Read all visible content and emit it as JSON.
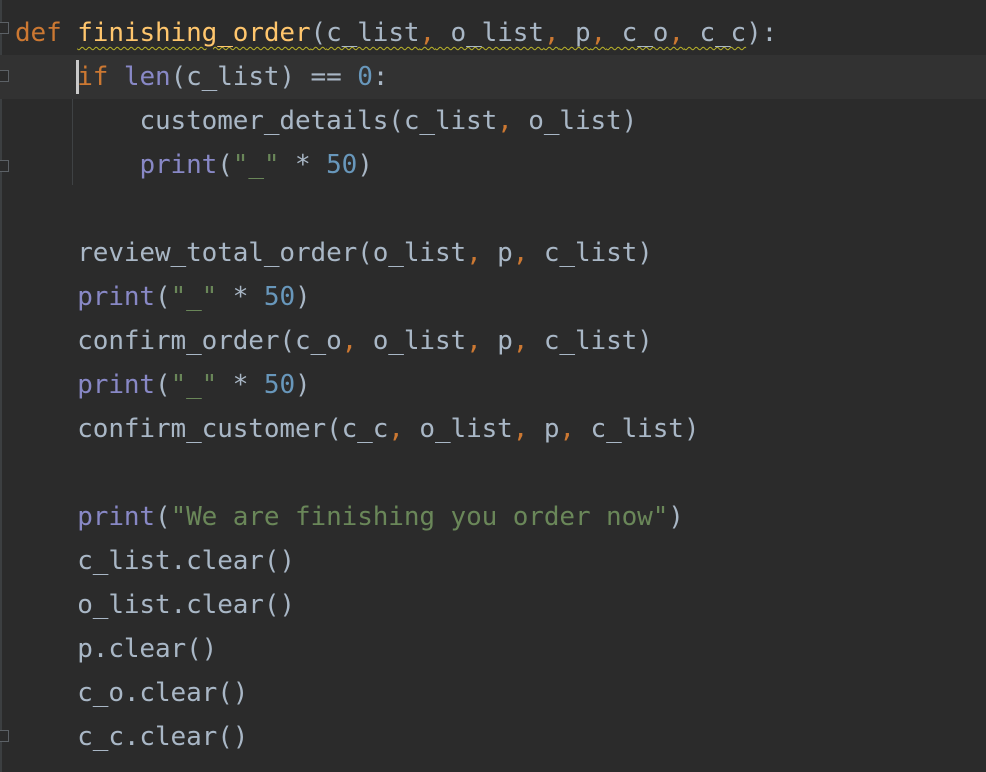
{
  "editor": {
    "language": "python",
    "colors": {
      "background": "#2b2b2b",
      "current_line": "#323232",
      "keyword": "#cc7832",
      "function_name": "#ffc66d",
      "builtin": "#8888c6",
      "number": "#6897bb",
      "string": "#6a8759",
      "default_text": "#a9b7c6",
      "warning_underline": "#bbb529"
    },
    "lines": [
      {
        "def_kw": "def",
        "space": " ",
        "func_name": "finishing_order",
        "open": "(",
        "p1": "c_list",
        "c1": ",",
        "p2": " o_list",
        "c2": ",",
        "p3": " p",
        "c3": ",",
        "p4": " c_o",
        "c4": ",",
        "p5": " c_c",
        "close": "):"
      },
      {
        "indent": "    ",
        "if_kw": "if",
        "space": " ",
        "len": "len",
        "args": "(c_list) == ",
        "zero": "0",
        "colon": ":"
      },
      {
        "indent": "        ",
        "call": "customer_details(c_list",
        "comma": ",",
        "rest": " o_list)"
      },
      {
        "indent": "        ",
        "print": "print",
        "open": "(",
        "str": "\"_\"",
        "op": " * ",
        "num": "50",
        "close": ")"
      },
      {
        "indent": "    ",
        "call": "review_total_order(o_list",
        "c1": ",",
        "a2": " p",
        "c2": ",",
        "a3": " c_list)"
      },
      {
        "indent": "    ",
        "print": "print",
        "open": "(",
        "str": "\"_\"",
        "op": " * ",
        "num": "50",
        "close": ")"
      },
      {
        "indent": "    ",
        "call": "confirm_order(c_o",
        "c1": ",",
        "a2": " o_list",
        "c2": ",",
        "a3": " p",
        "c3": ",",
        "a4": " c_list)"
      },
      {
        "indent": "    ",
        "print": "print",
        "open": "(",
        "str": "\"_\"",
        "op": " * ",
        "num": "50",
        "close": ")"
      },
      {
        "indent": "    ",
        "call": "confirm_customer(c_c",
        "c1": ",",
        "a2": " o_list",
        "c2": ",",
        "a3": " p",
        "c3": ",",
        "a4": " c_list)"
      },
      {
        "indent": "    ",
        "print": "print",
        "open": "(",
        "str": "\"We are finishing you order now\"",
        "close": ")"
      },
      {
        "indent": "    ",
        "code": "c_list.clear()"
      },
      {
        "indent": "    ",
        "code": "o_list.clear()"
      },
      {
        "indent": "    ",
        "code": "p.clear()"
      },
      {
        "indent": "    ",
        "code": "c_o.clear()"
      },
      {
        "indent": "    ",
        "code": "c_c.clear()"
      }
    ]
  }
}
